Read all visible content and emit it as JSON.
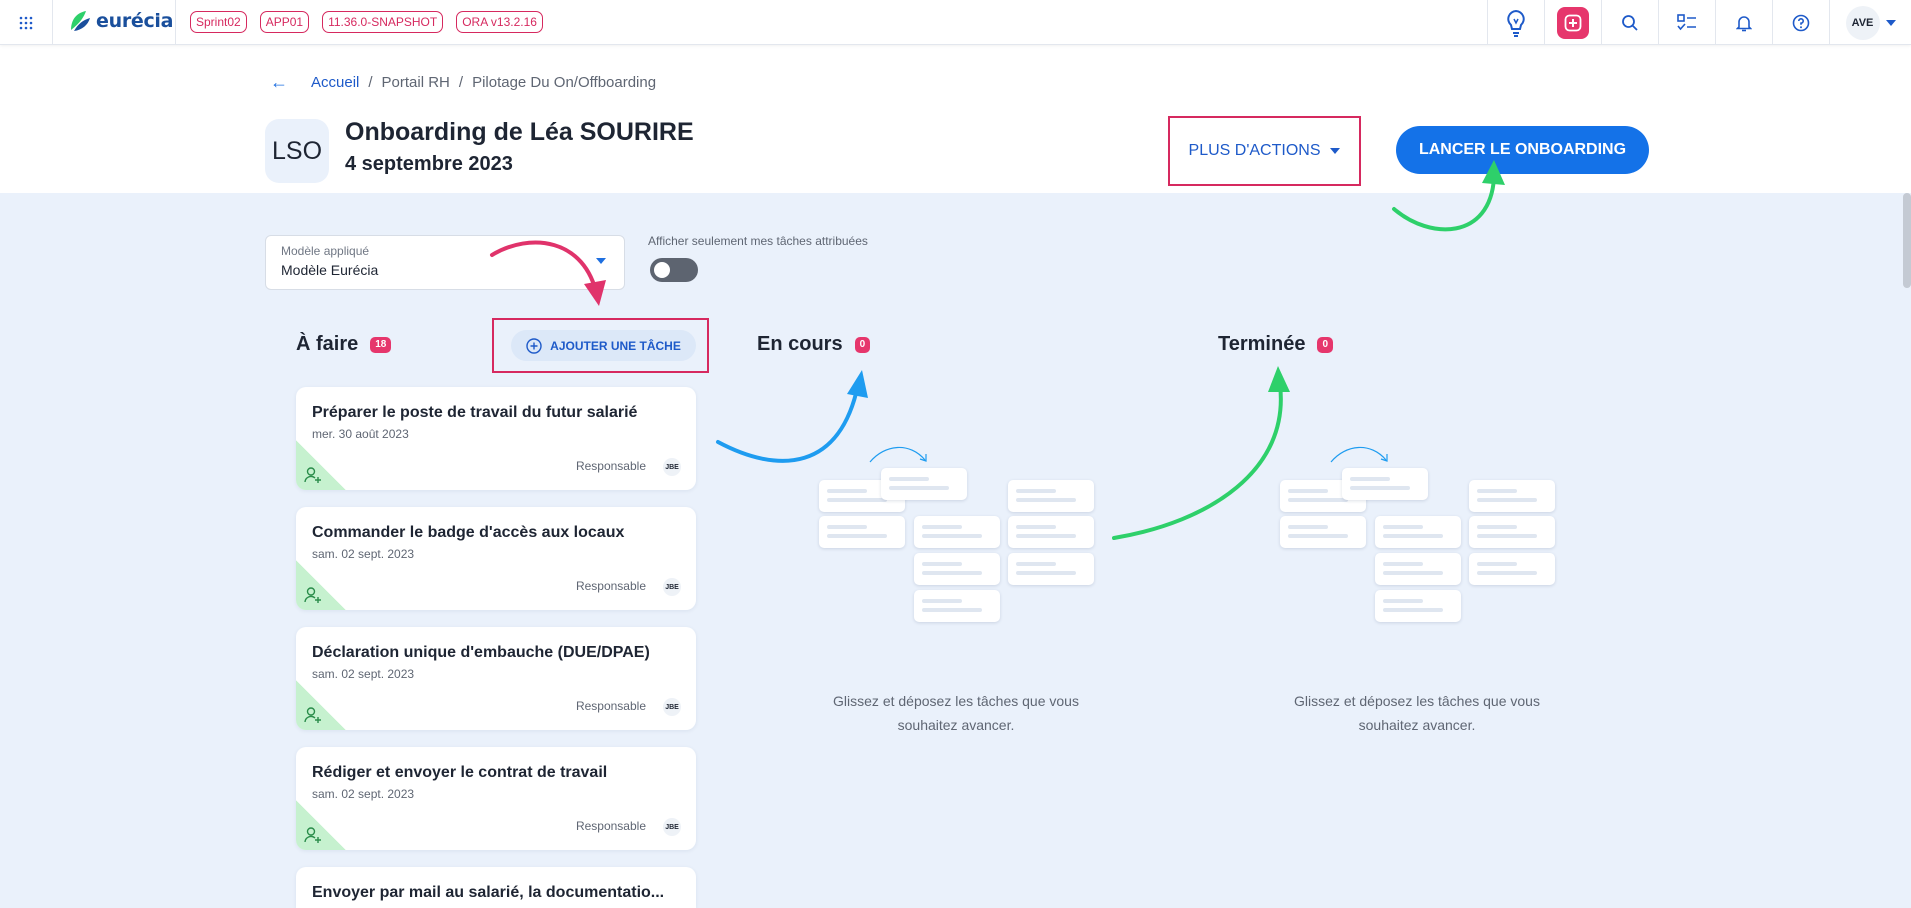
{
  "topbar": {
    "logo_text": "eurécia",
    "env_tags": [
      "Sprint02",
      "APP01",
      "11.36.0-SNAPSHOT",
      "ORA v13.2.16"
    ],
    "icons": [
      "lightbulb-icon",
      "add-icon",
      "search-icon",
      "tasks-icon",
      "bell-icon",
      "help-icon"
    ],
    "user_initials": "AVE"
  },
  "breadcrumb": {
    "back": "←",
    "items": [
      "Accueil",
      "Portail RH",
      "Pilotage Du On/Offboarding"
    ],
    "sep": "/"
  },
  "header": {
    "initials": "LSO",
    "title": "Onboarding de Léa SOURIRE",
    "date": "4 septembre 2023",
    "more_actions": "PLUS D'ACTIONS",
    "launch": "LANCER LE ONBOARDING"
  },
  "controls": {
    "model_label": "Modèle appliqué",
    "model_value": "Modèle Eurécia",
    "toggle_label": "Afficher seulement mes tâches attribuées",
    "toggle_on": false
  },
  "columns": {
    "todo": {
      "title": "À faire",
      "count": "18",
      "add_task": "AJOUTER UNE TÂCHE"
    },
    "in_progress": {
      "title": "En cours",
      "count": "0",
      "empty": "Glissez et déposez les tâches que vous souhaitez avancer."
    },
    "done": {
      "title": "Terminée",
      "count": "0",
      "empty": "Glissez et déposez les tâches que vous souhaitez avancer."
    }
  },
  "tasks": [
    {
      "title": "Préparer le poste de travail du futur salarié",
      "date": "mer. 30 août 2023",
      "role": "Responsable",
      "assignee": "JBE"
    },
    {
      "title": "Commander le badge d'accès aux locaux",
      "date": "sam. 02 sept. 2023",
      "role": "Responsable",
      "assignee": "JBE"
    },
    {
      "title": "Déclaration unique d'embauche (DUE/DPAE)",
      "date": "sam. 02 sept. 2023",
      "role": "Responsable",
      "assignee": "JBE"
    },
    {
      "title": "Rédiger et envoyer le contrat de travail",
      "date": "sam. 02 sept. 2023",
      "role": "Responsable",
      "assignee": "JBE"
    },
    {
      "title": "Envoyer par mail au salarié, la documentatio...",
      "date": "",
      "role": "",
      "assignee": ""
    }
  ],
  "colors": {
    "accent": "#1472e8",
    "brand": "#1a4f9c",
    "highlight": "#d6295f",
    "badge": "#e6366c",
    "arrow_pink": "#e0336b",
    "arrow_blue": "#1e9cf0",
    "arrow_green": "#2ed06a"
  }
}
